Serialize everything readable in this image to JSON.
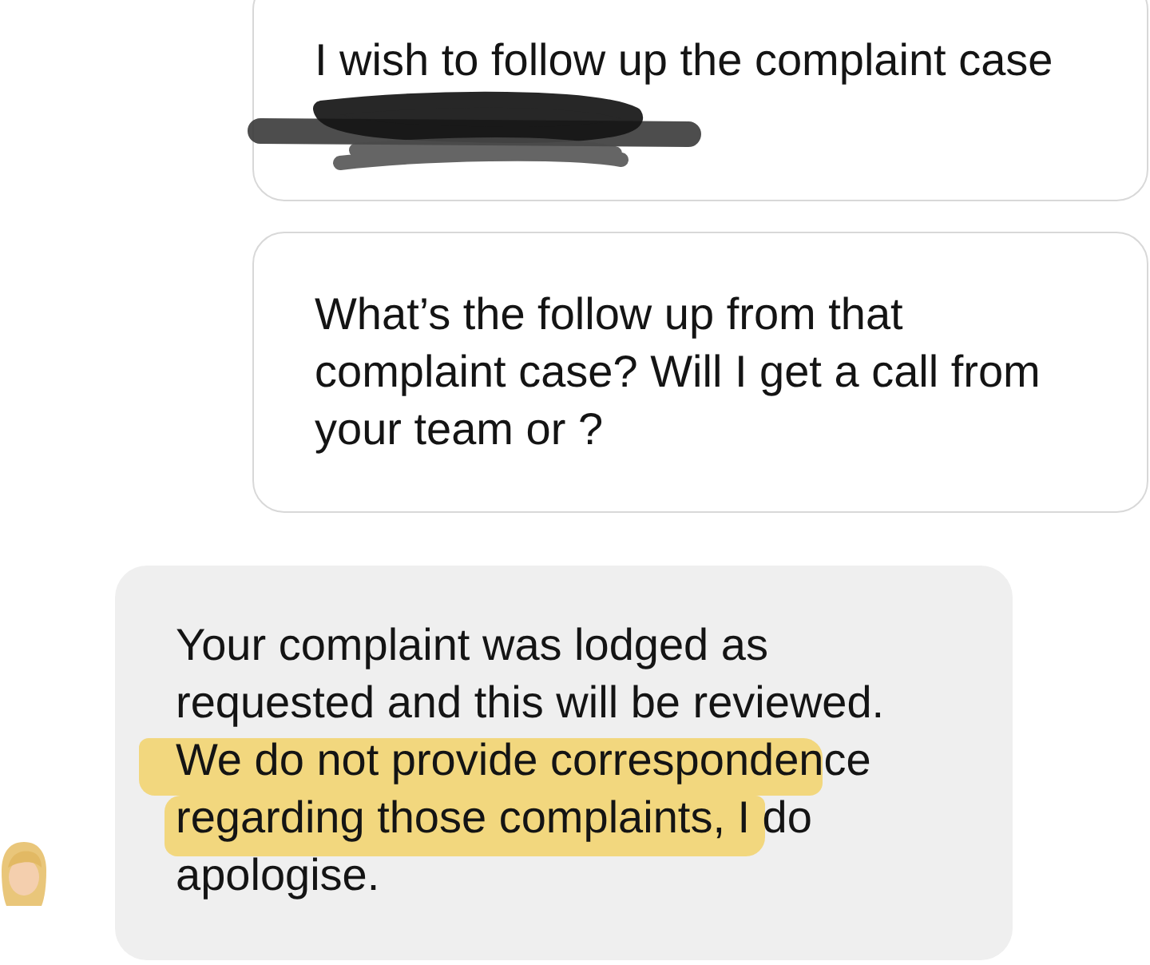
{
  "messages": [
    {
      "kind": "outgoing",
      "text": "I wish to follow up the complaint case",
      "redacted": true,
      "highlighted": false
    },
    {
      "kind": "outgoing",
      "text": "What’s the follow up from that complaint case? Will I get a call from your team or ?",
      "redacted": false,
      "highlighted": false
    },
    {
      "kind": "incoming",
      "text": "Your complaint was lodged as requested and this will be reviewed. We do not provide correspondence regarding those complaints, I do apologise.",
      "redacted": false,
      "highlighted": true
    }
  ]
}
